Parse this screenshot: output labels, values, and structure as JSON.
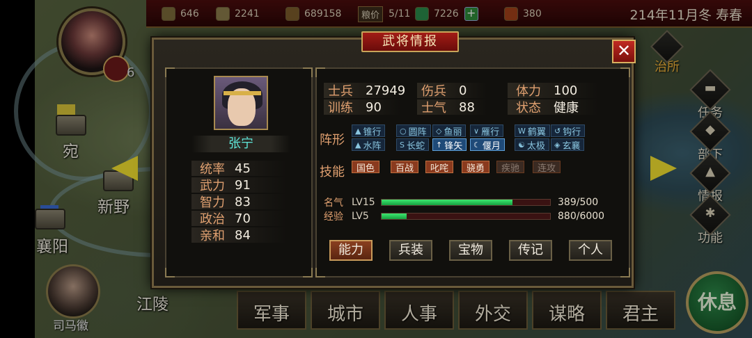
{
  "topbar": {
    "resources": [
      {
        "icon": "gold-icon",
        "value": "646"
      },
      {
        "icon": "coin-bag-icon",
        "value": "2241"
      },
      {
        "icon": "grain-icon",
        "value": "689158"
      }
    ],
    "grain_price_label": "粮价",
    "grain_price_value": "5/11",
    "troop_value": "7226",
    "plus_label": "+",
    "token_value": "380",
    "date": "214年11月冬 寿春"
  },
  "lord": {
    "level": "6"
  },
  "map": {
    "cities": [
      {
        "name": "宛"
      },
      {
        "name": "新野"
      },
      {
        "name": "襄阳"
      },
      {
        "name": "江陵"
      }
    ]
  },
  "advisor": {
    "name": "司马徽"
  },
  "side_menu": [
    {
      "key": "zhisuo",
      "label": "治所",
      "glyph": "▲"
    },
    {
      "key": "renwu",
      "label": "任务",
      "glyph": "▬"
    },
    {
      "key": "buxia",
      "label": "部下",
      "glyph": "◆"
    },
    {
      "key": "qingbao",
      "label": "情报",
      "glyph": "▲"
    },
    {
      "key": "gongneng",
      "label": "功能",
      "glyph": "✱"
    }
  ],
  "rest_label": "休息",
  "commands": [
    "军事",
    "城市",
    "人事",
    "外交",
    "谋略",
    "君主"
  ],
  "dialog": {
    "title": "武将情报",
    "close": "✕",
    "hero": {
      "name": "张宁",
      "attributes": [
        {
          "k": "统率",
          "v": "45"
        },
        {
          "k": "武力",
          "v": "91"
        },
        {
          "k": "智力",
          "v": "83"
        },
        {
          "k": "政治",
          "v": "70"
        },
        {
          "k": "亲和",
          "v": "84"
        }
      ]
    },
    "stats": [
      {
        "k": "士兵",
        "v": "27949"
      },
      {
        "k": "伤兵",
        "v": "0"
      },
      {
        "k": "体力",
        "v": "100"
      },
      {
        "k": "训练",
        "v": "90"
      },
      {
        "k": "士气",
        "v": "88"
      },
      {
        "k": "状态",
        "v": "健康"
      }
    ],
    "formation_label": "阵形",
    "formations": [
      {
        "sym": "▲",
        "label": "锥行",
        "active": false
      },
      {
        "sym": "○",
        "label": "圆阵",
        "active": false
      },
      {
        "sym": "◇",
        "label": "鱼丽",
        "active": false
      },
      {
        "sym": "∨",
        "label": "雁行",
        "active": false
      },
      {
        "sym": "W",
        "label": "鹤翼",
        "active": false
      },
      {
        "sym": "↺",
        "label": "钩行",
        "active": false
      },
      {
        "sym": "▲",
        "label": "水阵",
        "active": false
      },
      {
        "sym": "S",
        "label": "长蛇",
        "active": false
      },
      {
        "sym": "↑",
        "label": "锋矢",
        "active": true
      },
      {
        "sym": "☾",
        "label": "偃月",
        "active": true
      },
      {
        "sym": "☯",
        "label": "太极",
        "active": false
      },
      {
        "sym": "◈",
        "label": "玄襄",
        "active": false
      }
    ],
    "skill_label": "技能",
    "skills": [
      {
        "label": "国色",
        "on": true
      },
      {
        "label": "百战",
        "on": true
      },
      {
        "label": "叱咤",
        "on": true
      },
      {
        "label": "骁勇",
        "on": true
      },
      {
        "label": "疾驰",
        "on": false
      },
      {
        "label": "连攻",
        "on": false
      }
    ],
    "bars": [
      {
        "k": "名气",
        "lv": "LV15",
        "text": "389/500",
        "fraction": 0.778
      },
      {
        "k": "经验",
        "lv": "LV5",
        "text": "880/6000",
        "fraction": 0.147
      }
    ],
    "tabs": [
      {
        "label": "能力",
        "active": true
      },
      {
        "label": "兵装",
        "active": false
      },
      {
        "label": "宝物",
        "active": false
      },
      {
        "label": "传记",
        "active": false
      },
      {
        "label": "个人",
        "active": false
      }
    ]
  }
}
